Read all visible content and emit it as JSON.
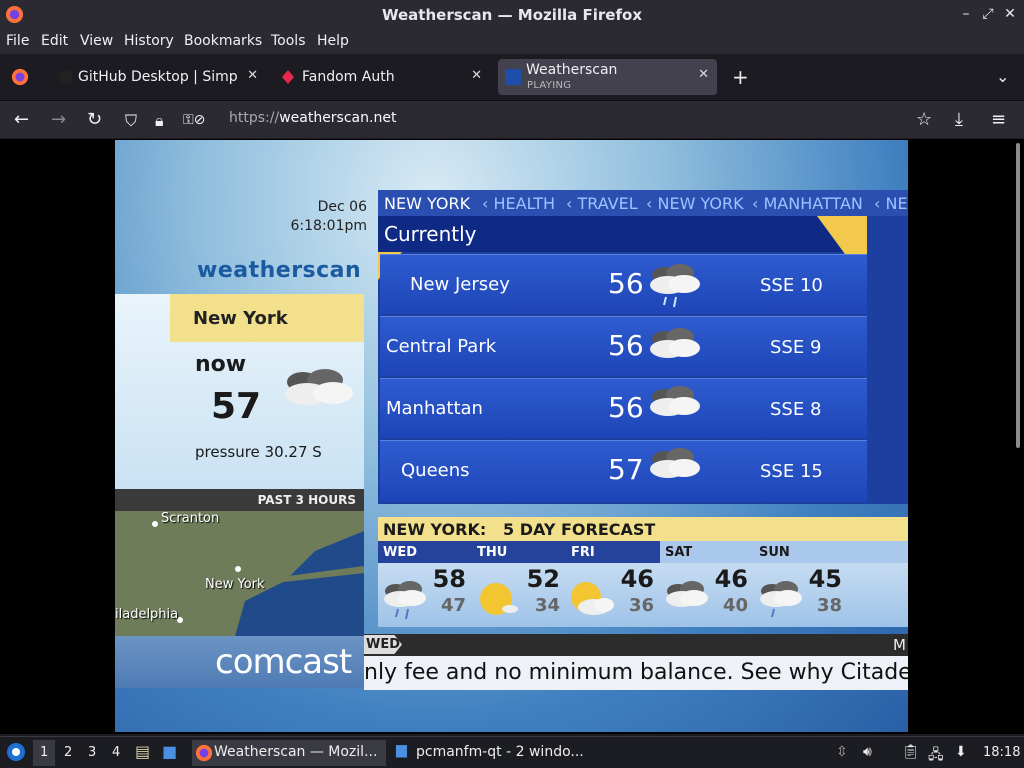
{
  "window": {
    "title": "Weatherscan — Mozilla Firefox"
  },
  "menu": [
    "File",
    "Edit",
    "View",
    "History",
    "Bookmarks",
    "Tools",
    "Help"
  ],
  "tabs": [
    {
      "label": "GitHub Desktop | Simple"
    },
    {
      "label": "Fandom Auth"
    },
    {
      "label": "Weatherscan",
      "sub": "PLAYING",
      "active": true
    }
  ],
  "nav": {
    "url_proto": "https://",
    "url_host": "weatherscan.net"
  },
  "weatherscan": {
    "date": "Dec 06",
    "time": "6:18:01pm",
    "logo": "weatherscan",
    "location": "New York",
    "now_label": "now",
    "now_temp": "57",
    "pressure": "pressure 30.27 S",
    "past_hours": "PAST 3 HOURS",
    "map_labels": {
      "scranton": "Scranton",
      "newyork": "New York",
      "philly": "iladelphia"
    },
    "sponsor": "comcast",
    "ticker": [
      "NEW YORK",
      "HEALTH",
      "TRAVEL",
      "NEW YORK",
      "MANHATTAN",
      "NE"
    ],
    "currently_title": "Currently",
    "current": [
      {
        "loc": "New Jersey",
        "temp": "56",
        "wind": "SSE 10",
        "icon": "rain-cloud-icon"
      },
      {
        "loc": "Central Park",
        "temp": "56",
        "wind": "SSE 9",
        "icon": "cloud-icon"
      },
      {
        "loc": "Manhattan",
        "temp": "56",
        "wind": "SSE 8",
        "icon": "cloud-icon"
      },
      {
        "loc": "Queens",
        "temp": "57",
        "wind": "SSE 15",
        "icon": "cloud-icon"
      }
    ],
    "forecast_title": "NEW YORK:   5 DAY FORECAST",
    "forecast": [
      {
        "day": "WED",
        "hi": "58",
        "lo": "47",
        "icon": "rain-cloud-icon"
      },
      {
        "day": "THU",
        "hi": "52",
        "lo": "34",
        "icon": "sun-icon"
      },
      {
        "day": "FRI",
        "hi": "46",
        "lo": "36",
        "icon": "partly-cloudy-icon"
      },
      {
        "day": "SAT",
        "hi": "46",
        "lo": "40",
        "icon": "cloud-icon"
      },
      {
        "day": "SUN",
        "hi": "45",
        "lo": "38",
        "icon": "rain-cloud-icon"
      }
    ],
    "strip_day": "WED",
    "strip_right": "M",
    "crawl": "nly fee and no minimum balance. See why Citadel"
  },
  "taskbar": {
    "workspaces": [
      "1",
      "2",
      "3",
      "4"
    ],
    "tasks": [
      "Weatherscan — Mozil...",
      "pcmanfm-qt - 2 windo..."
    ],
    "clock": "18:18"
  }
}
